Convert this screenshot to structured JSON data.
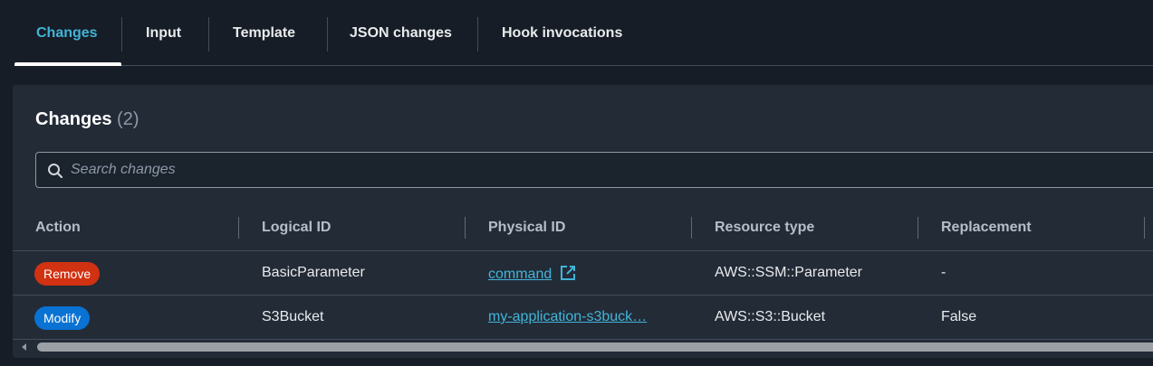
{
  "tabs": [
    {
      "label": "Changes",
      "active": true
    },
    {
      "label": "Input"
    },
    {
      "label": "Template"
    },
    {
      "label": "JSON changes"
    },
    {
      "label": "Hook invocations"
    }
  ],
  "panel": {
    "title": "Changes",
    "count": "(2)",
    "search_placeholder": "Search changes"
  },
  "table": {
    "columns": [
      "Action",
      "Logical ID",
      "Physical ID",
      "Resource type",
      "Replacement"
    ],
    "rows": [
      {
        "action": "Remove",
        "action_color": "#d13212",
        "logical_id": "BasicParameter",
        "physical_id": "command",
        "external_link": true,
        "resource_type": "AWS::SSM::Parameter",
        "replacement": "-"
      },
      {
        "action": "Modify",
        "action_color": "#0972d3",
        "logical_id": "S3Bucket",
        "physical_id": "my-application-s3buck…",
        "resource_type": "AWS::S3::Bucket",
        "replacement": "False"
      }
    ]
  },
  "colors": {
    "accent": "#42b4d8",
    "background": "#161d26",
    "panel": "#232b37"
  }
}
